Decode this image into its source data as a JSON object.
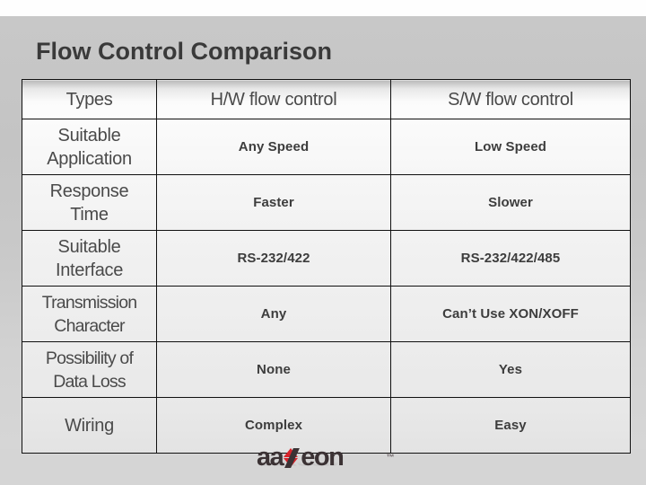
{
  "slide": {
    "title": "Flow Control Comparison"
  },
  "table": {
    "headers": [
      "Types",
      "H/W flow control",
      "S/W flow control"
    ],
    "rows": [
      {
        "label": "Suitable\nApplication",
        "hw": "Any Speed",
        "sw": "Low Speed"
      },
      {
        "label": "Response\nTime",
        "hw": "Faster",
        "sw": "Slower"
      },
      {
        "label": "Suitable\nInterface",
        "hw": "RS-232/422",
        "sw": "RS-232/422/485"
      },
      {
        "label": "Transmission\nCharacter",
        "hw": "Any",
        "sw": "Can’t Use XON/XOFF"
      },
      {
        "label": "Possibility of\nData Loss",
        "hw": "None",
        "sw": "Yes"
      },
      {
        "label": "Wiring",
        "hw": "Complex",
        "sw": "Easy"
      }
    ]
  },
  "logo": {
    "part1": "aa",
    "part2": "eon",
    "trademark": "™",
    "full_text": "aaxeon",
    "accent_color": "#d8232a",
    "text_color": "#3b3234"
  }
}
